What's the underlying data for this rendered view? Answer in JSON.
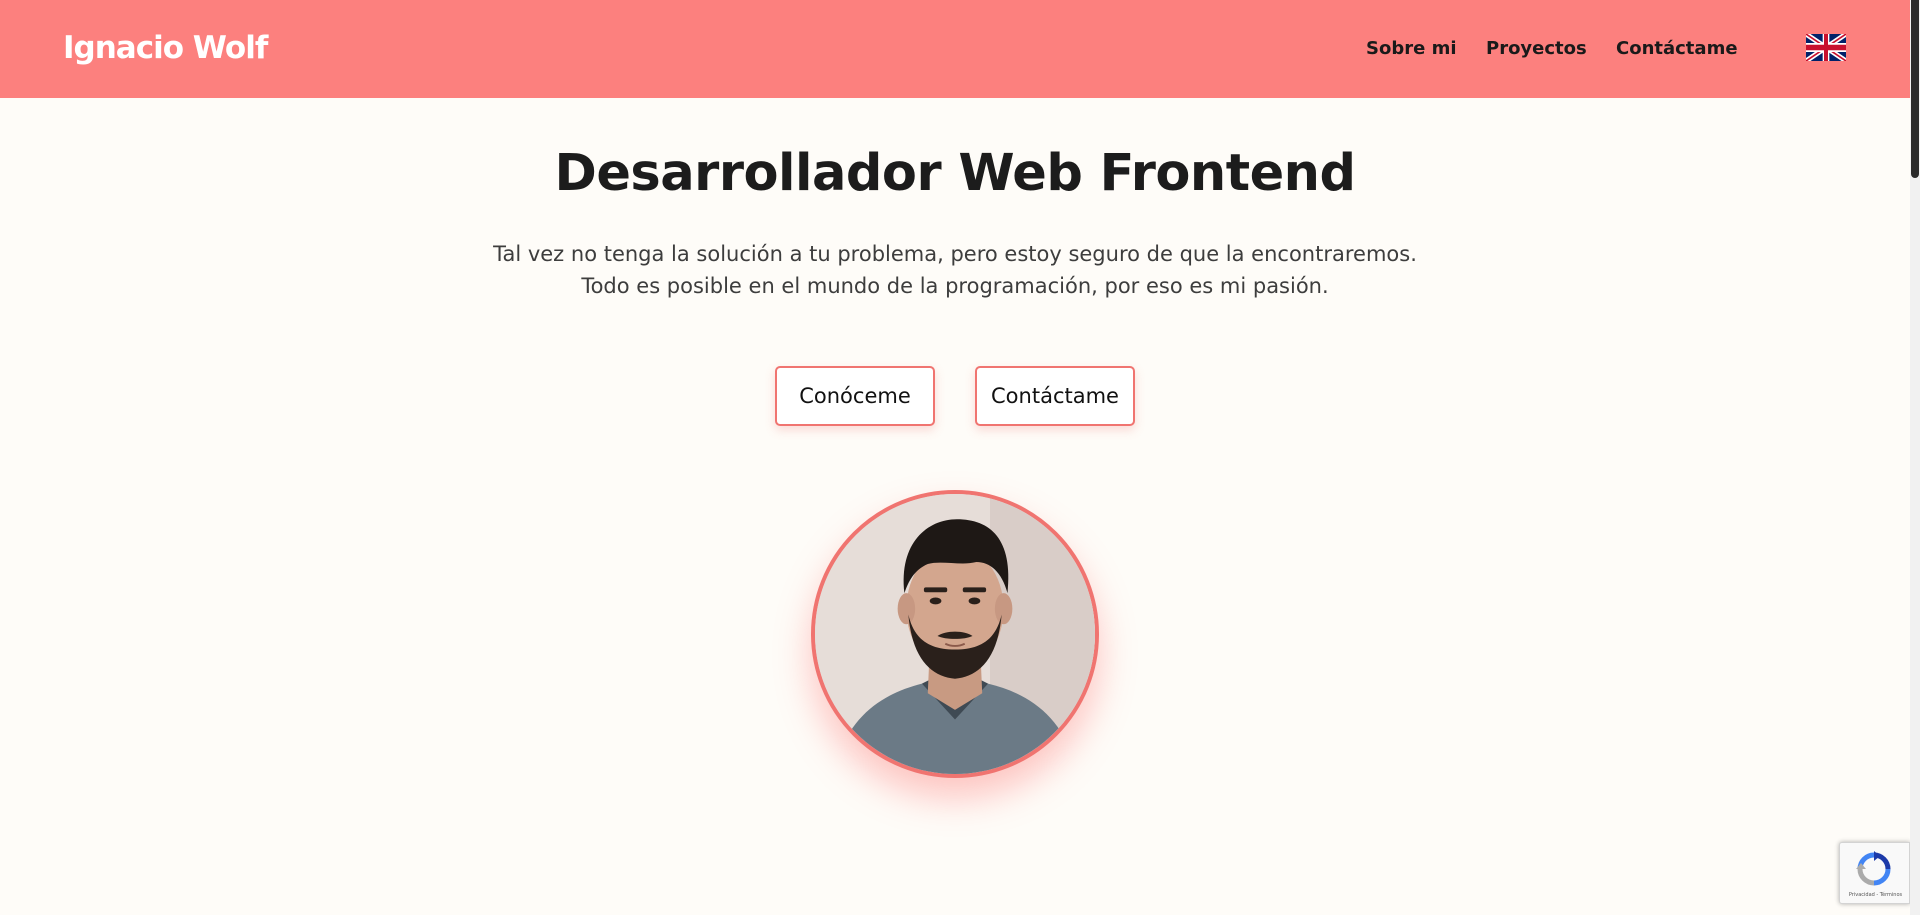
{
  "header": {
    "logo": "Ignacio Wolf",
    "nav": [
      {
        "label": "Sobre mi"
      },
      {
        "label": "Proyectos"
      },
      {
        "label": "Contáctame"
      }
    ],
    "language_toggle_icon": "uk-flag-icon"
  },
  "hero": {
    "title": "Desarrollador Web Frontend",
    "text_line1": "Tal vez no tenga la solución a tu problema, pero estoy seguro de que la encontraremos.",
    "text_line2": "Todo es posible en el mundo de la programación, por eso es mi pasión.",
    "buttons": {
      "know_me": "Conóceme",
      "contact_me": "Contáctame"
    },
    "avatar_icon": "profile-photo"
  },
  "recaptcha": {
    "icon": "recaptcha-icon",
    "privacy": "Privacidad",
    "separator": " - ",
    "terms": "Términos"
  },
  "colors": {
    "header_bg": "#fc807e",
    "accent": "#f07470",
    "page_bg": "#fefcf8",
    "text": "#1c1c1c"
  }
}
